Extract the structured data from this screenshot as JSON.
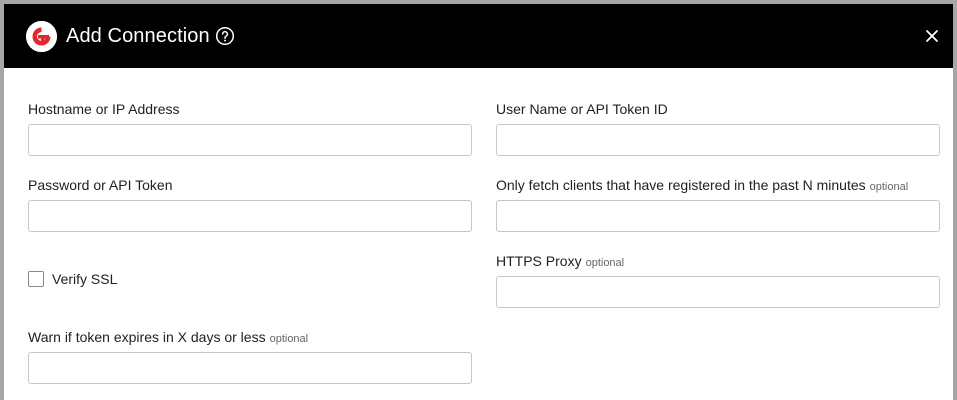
{
  "dialog": {
    "title": "Add Connection",
    "icons": {
      "logo": "brand-logo-icon",
      "help": "help-circle-icon",
      "close": "close-icon"
    }
  },
  "form": {
    "hostname": {
      "label": "Hostname or IP Address",
      "value": ""
    },
    "username": {
      "label": "User Name or API Token ID",
      "value": ""
    },
    "password": {
      "label": "Password or API Token",
      "value": ""
    },
    "fetch_minutes": {
      "label": "Only fetch clients that have registered in the past N minutes",
      "tag": "optional",
      "value": ""
    },
    "verify_ssl": {
      "label": "Verify SSL",
      "checked": false
    },
    "https_proxy": {
      "label": "HTTPS Proxy",
      "tag": "optional",
      "value": ""
    },
    "token_expiry": {
      "label": "Warn if token expires in X days or less",
      "tag": "optional",
      "value": ""
    }
  },
  "colors": {
    "header_bg": "#000000",
    "logo_red": "#e3262f",
    "input_border": "#c6c6c6"
  }
}
